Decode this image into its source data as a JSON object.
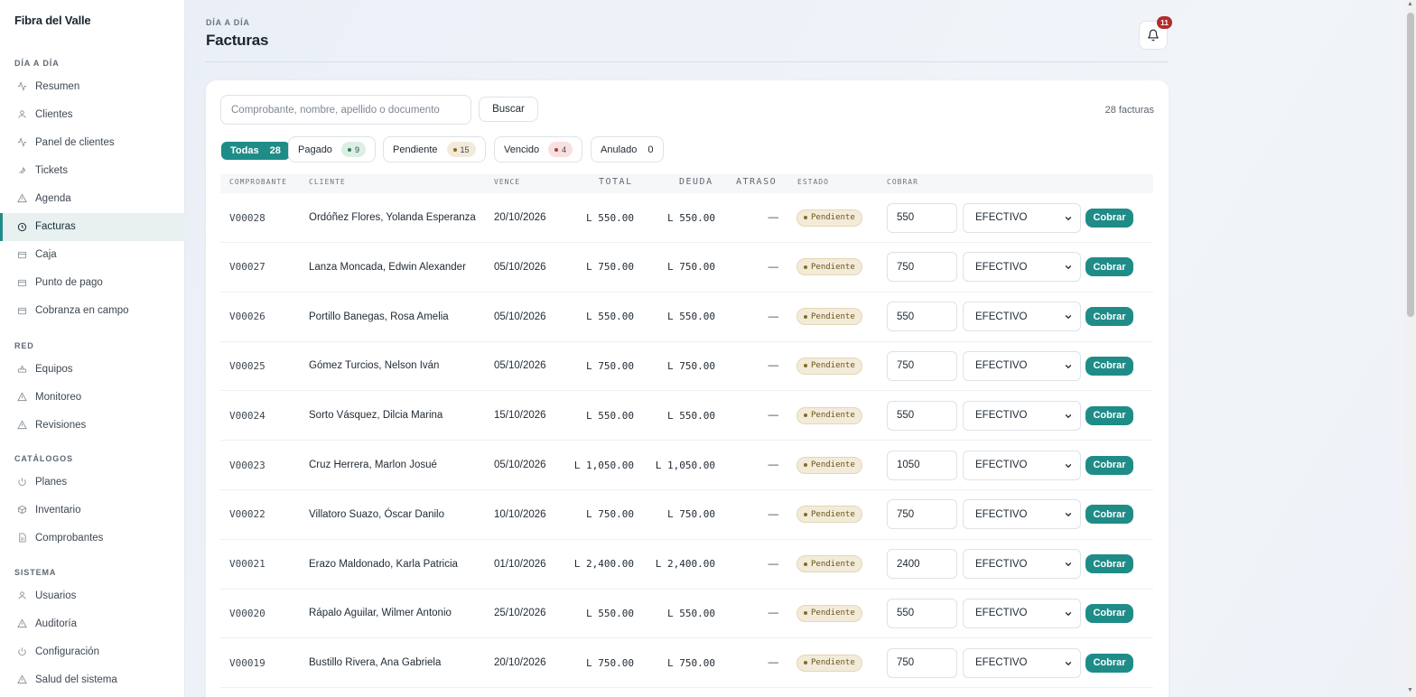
{
  "brand": "Fibra del Valle",
  "sidebar": {
    "sections": [
      {
        "title": "DÍA A DÍA",
        "items": [
          {
            "label": "Resumen",
            "icon": "activity-icon"
          },
          {
            "label": "Clientes",
            "icon": "user-icon"
          },
          {
            "label": "Panel de clientes",
            "icon": "activity-icon"
          },
          {
            "label": "Tickets",
            "icon": "wrench-icon"
          },
          {
            "label": "Agenda",
            "icon": "warning-icon"
          },
          {
            "label": "Facturas",
            "icon": "clock-icon",
            "active": true
          },
          {
            "label": "Caja",
            "icon": "card-icon"
          },
          {
            "label": "Punto de pago",
            "icon": "card-icon"
          },
          {
            "label": "Cobranza en campo",
            "icon": "card-icon"
          }
        ]
      },
      {
        "title": "RED",
        "items": [
          {
            "label": "Equipos",
            "icon": "router-icon"
          },
          {
            "label": "Monitoreo",
            "icon": "warning-icon"
          },
          {
            "label": "Revisiones",
            "icon": "warning-icon"
          }
        ]
      },
      {
        "title": "CATÁLOGOS",
        "items": [
          {
            "label": "Planes",
            "icon": "power-icon"
          },
          {
            "label": "Inventario",
            "icon": "box-icon"
          },
          {
            "label": "Comprobantes",
            "icon": "document-icon"
          }
        ]
      },
      {
        "title": "SISTEMA",
        "items": [
          {
            "label": "Usuarios",
            "icon": "user-icon"
          },
          {
            "label": "Auditoría",
            "icon": "warning-icon"
          },
          {
            "label": "Configuración",
            "icon": "power-icon"
          },
          {
            "label": "Salud del sistema",
            "icon": "warning-icon"
          }
        ]
      }
    ]
  },
  "header": {
    "breadcrumb": "DÍA A DÍA",
    "title": "Facturas",
    "notifications_count": "11"
  },
  "search": {
    "placeholder": "Comprobante, nombre, apellido o documento",
    "value": "",
    "button_label": "Buscar"
  },
  "count_label": "28 facturas",
  "filters": [
    {
      "label": "Todas",
      "count": "28",
      "active": true
    },
    {
      "label": "Pagado",
      "count": "9",
      "color": "#2f7d5b",
      "bg": "#dcefe5"
    },
    {
      "label": "Pendiente",
      "count": "15",
      "color": "#8a6a20",
      "bg": "#f3ebd9"
    },
    {
      "label": "Vencido",
      "count": "4",
      "color": "#b33a3a",
      "bg": "#f8e0e0"
    },
    {
      "label": "Anulado",
      "count": "0"
    }
  ],
  "table": {
    "columns": {
      "comprobante": "COMPROBANTE",
      "cliente": "CLIENTE",
      "vence": "VENCE",
      "total": "TOTAL",
      "deuda": "DEUDA",
      "atraso": "ATRASO",
      "estado": "ESTADO",
      "cobrar": "COBRAR"
    },
    "rows": [
      {
        "comprobante": "V00028",
        "cliente": "Ordóñez Flores, Yolanda Esperanza",
        "vence": "20/10/2026",
        "total": "L 550.00",
        "deuda": "L 550.00",
        "atraso": "—",
        "estado": "Pendiente",
        "monto": "550",
        "metodo": "EFECTIVO",
        "accion": "Cobrar"
      },
      {
        "comprobante": "V00027",
        "cliente": "Lanza Moncada, Edwin Alexander",
        "vence": "05/10/2026",
        "total": "L 750.00",
        "deuda": "L 750.00",
        "atraso": "—",
        "estado": "Pendiente",
        "monto": "750",
        "metodo": "EFECTIVO",
        "accion": "Cobrar"
      },
      {
        "comprobante": "V00026",
        "cliente": "Portillo Banegas, Rosa Amelia",
        "vence": "05/10/2026",
        "total": "L 550.00",
        "deuda": "L 550.00",
        "atraso": "—",
        "estado": "Pendiente",
        "monto": "550",
        "metodo": "EFECTIVO",
        "accion": "Cobrar"
      },
      {
        "comprobante": "V00025",
        "cliente": "Gómez Turcios, Nelson Iván",
        "vence": "05/10/2026",
        "total": "L 750.00",
        "deuda": "L 750.00",
        "atraso": "—",
        "estado": "Pendiente",
        "monto": "750",
        "metodo": "EFECTIVO",
        "accion": "Cobrar"
      },
      {
        "comprobante": "V00024",
        "cliente": "Sorto Vásquez, Dilcia Marina",
        "vence": "15/10/2026",
        "total": "L 550.00",
        "deuda": "L 550.00",
        "atraso": "—",
        "estado": "Pendiente",
        "monto": "550",
        "metodo": "EFECTIVO",
        "accion": "Cobrar"
      },
      {
        "comprobante": "V00023",
        "cliente": "Cruz Herrera, Marlon Josué",
        "vence": "05/10/2026",
        "total": "L 1,050.00",
        "deuda": "L 1,050.00",
        "atraso": "—",
        "estado": "Pendiente",
        "monto": "1050",
        "metodo": "EFECTIVO",
        "accion": "Cobrar"
      },
      {
        "comprobante": "V00022",
        "cliente": "Villatoro Suazo, Óscar Danilo",
        "vence": "10/10/2026",
        "total": "L 750.00",
        "deuda": "L 750.00",
        "atraso": "—",
        "estado": "Pendiente",
        "monto": "750",
        "metodo": "EFECTIVO",
        "accion": "Cobrar"
      },
      {
        "comprobante": "V00021",
        "cliente": "Erazo Maldonado, Karla Patricia",
        "vence": "01/10/2026",
        "total": "L 2,400.00",
        "deuda": "L 2,400.00",
        "atraso": "—",
        "estado": "Pendiente",
        "monto": "2400",
        "metodo": "EFECTIVO",
        "accion": "Cobrar"
      },
      {
        "comprobante": "V00020",
        "cliente": "Rápalo Aguilar, Wilmer Antonio",
        "vence": "25/10/2026",
        "total": "L 550.00",
        "deuda": "L 550.00",
        "atraso": "—",
        "estado": "Pendiente",
        "monto": "550",
        "metodo": "EFECTIVO",
        "accion": "Cobrar"
      },
      {
        "comprobante": "V00019",
        "cliente": "Bustillo Rivera, Ana Gabriela",
        "vence": "20/10/2026",
        "total": "L 750.00",
        "deuda": "L 750.00",
        "atraso": "—",
        "estado": "Pendiente",
        "monto": "750",
        "metodo": "EFECTIVO",
        "accion": "Cobrar"
      }
    ]
  },
  "colors": {
    "accent": "#1f8c88",
    "badge": "#b32b2b"
  }
}
